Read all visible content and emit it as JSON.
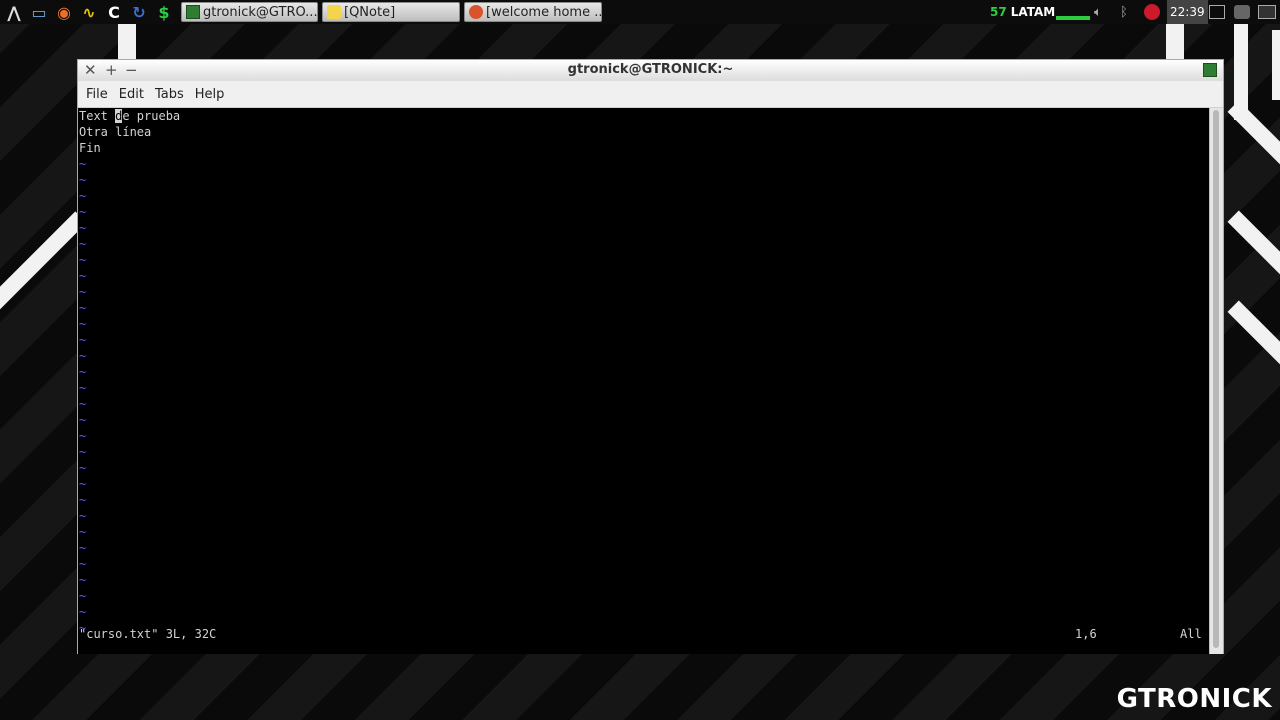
{
  "panel": {
    "launchers": [
      {
        "name": "app-menu-icon",
        "glyph": "⋀"
      },
      {
        "name": "file-manager-icon",
        "glyph": "▭"
      },
      {
        "name": "firefox-icon",
        "glyph": "◉"
      },
      {
        "name": "qnote-icon",
        "glyph": "∿"
      },
      {
        "name": "c-app-icon",
        "glyph": "C"
      },
      {
        "name": "sync-icon",
        "glyph": "↻"
      },
      {
        "name": "dollar-icon",
        "glyph": "$"
      }
    ],
    "tasks": [
      {
        "label": "gtronick@GTRO...",
        "icon": "terminal-icon"
      },
      {
        "label": "[QNote]",
        "icon": "note-icon"
      },
      {
        "label": "[welcome home ...",
        "icon": "browser-icon"
      }
    ],
    "tray": {
      "count": "57",
      "keyboard_layout": "LATAM",
      "clock": "22:39"
    }
  },
  "window": {
    "title": "gtronick@GTRONICK:~",
    "menu": [
      "File",
      "Edit",
      "Tabs",
      "Help"
    ]
  },
  "terminal": {
    "line1_before": "Text ",
    "line1_cursor": "d",
    "line1_after": "e prueba",
    "line2": "Otra línea",
    "line3": "Fin",
    "tilde": "~",
    "status_file": "\"curso.txt\" 3L, 32C",
    "status_pos": "1,6",
    "status_scroll": "All"
  },
  "watermark": "GTRONICK"
}
